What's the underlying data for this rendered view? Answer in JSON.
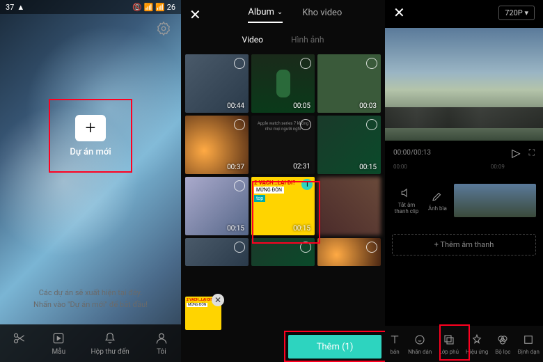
{
  "panel1": {
    "status_time": "37",
    "status_icons": "📷",
    "status_right": "📵 📶 📶 26",
    "new_project_label": "Dự án mới",
    "hint_line1": "Các dự án sẽ xuất hiện tại đây.",
    "hint_line2": "Nhấn vào \"Dự án mới\" để bắt đầu!",
    "bottombar": {
      "edit": "Mẫu",
      "template": "Hộp thư đến",
      "me": "Tôi"
    }
  },
  "panel2": {
    "tab_album": "Album",
    "tab_storage": "Kho video",
    "subtab_video": "Video",
    "subtab_image": "Hình ảnh",
    "thumbs": {
      "t0": "00:44",
      "t1": "00:05",
      "t2": "00:03",
      "t3": "00:37",
      "t4": "02:31",
      "t5": "00:15",
      "t6": "00:15",
      "t7": "00:15",
      "t7_label1": "2 VẠCH…LẠI ĐI?",
      "t7_label2": "MỪNG ĐÓN",
      "t7_label3": "top",
      "t7_badge": "1"
    },
    "add_button": "Thêm (1)"
  },
  "panel3": {
    "resolution": "720P ▾",
    "time_current": "00:00",
    "time_total": "00:13",
    "tick1": "00:00",
    "tick2": "00:09",
    "tool_mute": "Tắt âm thanh clip",
    "tool_cover": "Ảnh bìa",
    "add_audio": "+ Thêm âm thanh",
    "bottombar": {
      "b0": "bản",
      "b1": "Nhãn dán",
      "b2": "Lớp phủ",
      "b3": "Hiệu ứng",
      "b4": "Bộ lọc",
      "b5": "Định dạn"
    }
  }
}
